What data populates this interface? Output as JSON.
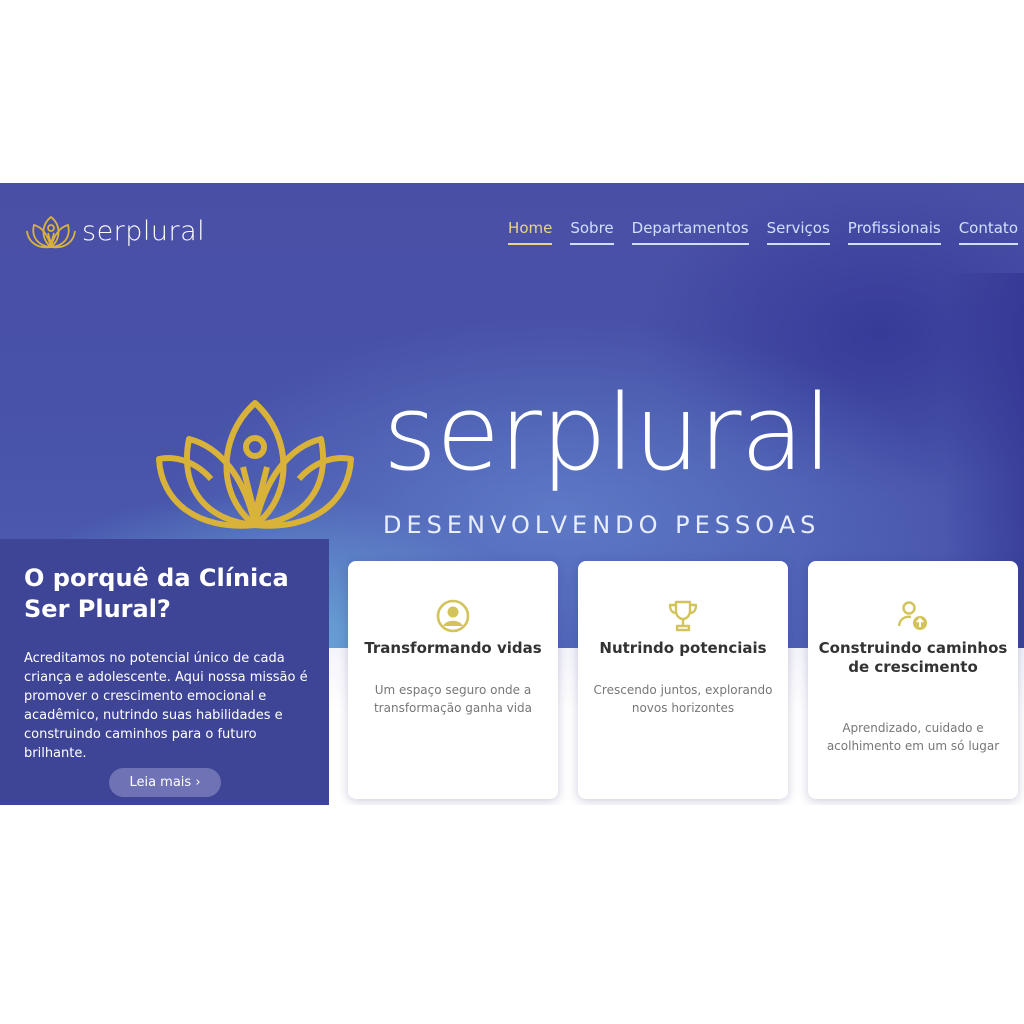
{
  "header": {
    "logo_text": "serplural",
    "nav": [
      "Home",
      "Sobre",
      "Departamentos",
      "Serviços",
      "Profissionais",
      "Contato"
    ],
    "active_nav": "Home"
  },
  "hero": {
    "brand_word": "serplural",
    "tagline": "DESENVOLVENDO PESSOAS"
  },
  "why": {
    "title": "O porquê da Clínica Ser Plural?",
    "body": "Acreditamos no potencial único de cada criança e adolescente. Aqui nossa missão é promover o crescimento emocional e acadêmico, nutrindo suas habilidades e construindo caminhos para o futuro brilhante.",
    "button": "Leia mais ›"
  },
  "cards": [
    {
      "icon": "user-circle-icon",
      "title": "Transformando vidas",
      "text": "Um espaço seguro onde a transformação ganha vida"
    },
    {
      "icon": "trophy-icon",
      "title": "Nutrindo potenciais",
      "text": "Crescendo juntos, explorando novos horizontes"
    },
    {
      "icon": "user-growth-icon",
      "title": "Construindo caminhos de crescimento",
      "text": "Aprendizado, cuidado e acolhimento em um só lugar"
    }
  ],
  "colors": {
    "hero_base": "#4a4fa6",
    "panel": "#3f4596",
    "gold": "#d9b23a",
    "nav_active": "#e9d48a",
    "icon": "#d2c35a"
  }
}
